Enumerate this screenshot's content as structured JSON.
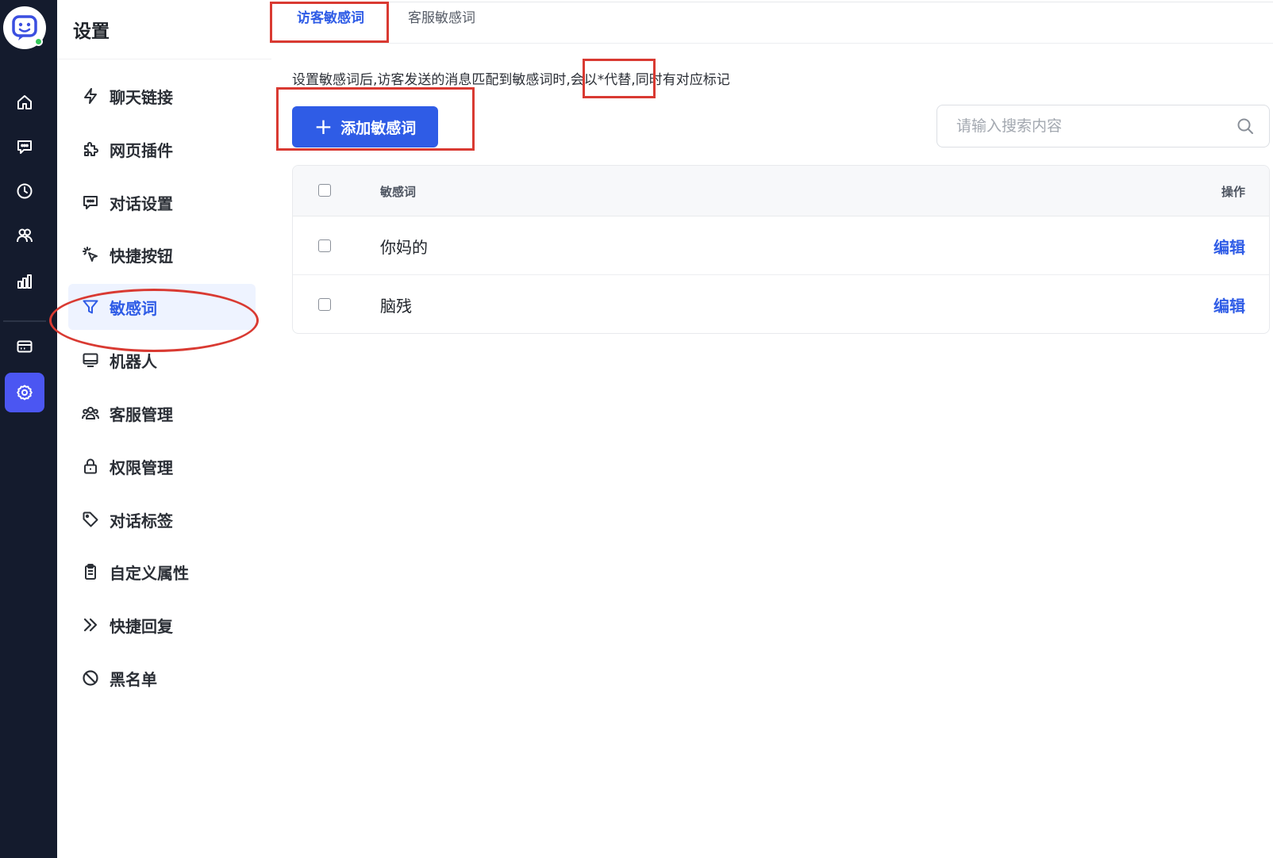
{
  "rail": {
    "icons": [
      "chat-bot-logo-icon",
      "home-icon",
      "chat-icon",
      "history-icon",
      "users-icon",
      "analytics-icon",
      "card-icon",
      "settings-icon"
    ],
    "accent": "#4b56f2"
  },
  "menu": {
    "title": "设置",
    "items": [
      {
        "label": "聊天链接",
        "icon": "lightning-icon"
      },
      {
        "label": "网页插件",
        "icon": "puzzle-icon"
      },
      {
        "label": "对话设置",
        "icon": "chat-bubble-icon"
      },
      {
        "label": "快捷按钮",
        "icon": "cursor-click-icon"
      },
      {
        "label": "敏感词",
        "icon": "filter-icon"
      },
      {
        "label": "机器人",
        "icon": "monitor-icon"
      },
      {
        "label": "客服管理",
        "icon": "team-icon"
      },
      {
        "label": "权限管理",
        "icon": "lock-icon"
      },
      {
        "label": "对话标签",
        "icon": "tag-icon"
      },
      {
        "label": "自定义属性",
        "icon": "clipboard-icon"
      },
      {
        "label": "快捷回复",
        "icon": "double-chevron-icon"
      },
      {
        "label": "黑名单",
        "icon": "ban-icon"
      }
    ],
    "active_index": 4
  },
  "tabs": [
    {
      "label": "访客敏感词",
      "active": true
    },
    {
      "label": "客服敏感词",
      "active": false
    }
  ],
  "description": "设置敏感词后,访客发送的消息匹配到敏感词时,会以*代替,同时有对应标记",
  "add_button": {
    "label": "添加敏感词"
  },
  "search": {
    "placeholder": "请输入搜索内容",
    "value": ""
  },
  "table": {
    "headers": {
      "word": "敏感词",
      "action": "操作"
    },
    "rows": [
      {
        "word": "你妈的",
        "action": "编辑"
      },
      {
        "word": "脑残",
        "action": "编辑"
      }
    ]
  },
  "colors": {
    "primary": "#2f5ce6",
    "annotation": "#d93a32",
    "rail_bg": "#141b2d"
  }
}
